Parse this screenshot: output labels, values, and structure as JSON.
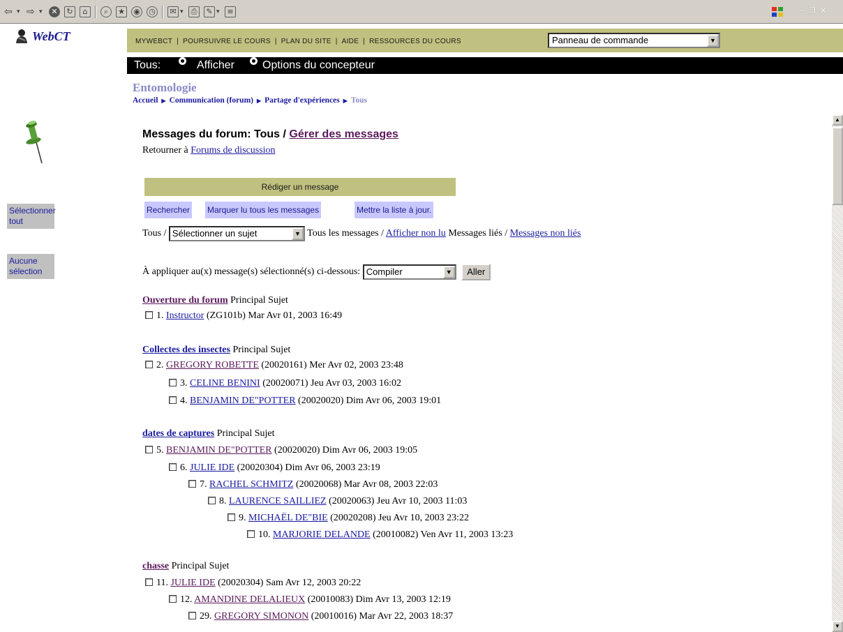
{
  "nav": {
    "links": [
      "MYWEBCT",
      "POURSUIVRE LE COURS",
      "PLAN DU SITE",
      "AIDE",
      "RESSOURCES DU COURS"
    ],
    "panel_select": "Panneau de commande"
  },
  "logo": {
    "text": "WebCT"
  },
  "mode": {
    "label": "Tous:",
    "option1": "Afficher",
    "option2": "Options du concepteur"
  },
  "course": {
    "title": "Entomologie",
    "breadcrumb": [
      "Accueil",
      "Communication (forum)",
      "Partage d'expériences"
    ],
    "breadcrumb_current": "Tous"
  },
  "sidebar": {
    "select_all": "Sélectionner tout",
    "select_none": "Aucune sélection"
  },
  "main": {
    "heading": "Messages du forum: Tous /",
    "heading_link": "Gérer des messages",
    "return_prefix": "Retourner à",
    "return_link": "Forums de discussion",
    "compose": "Rédiger un message",
    "actions": [
      "Rechercher",
      "Marquer lu tous les messages",
      "Mettre la liste à jour."
    ],
    "filter_prefix": "Tous /",
    "subject_select": "Sélectionner un sujet",
    "filter_all": "Tous  les messages /",
    "filter_unread": "Afficher non lu",
    "filter_linked": "Messages liés /",
    "filter_unlinked": "Messages non liés",
    "apply_label": "À appliquer au(x) message(s) sélectionné(s) ci-dessous:",
    "apply_select": "Compiler",
    "go": "Aller"
  },
  "topics": [
    {
      "title": "Ouverture du forum",
      "suffix": "Principal Sujet",
      "visited": true
    },
    {
      "title": "Collectes des insectes",
      "suffix": "Principal Sujet",
      "visited": false
    },
    {
      "title": "dates de captures",
      "suffix": "Principal Sujet",
      "visited": false
    },
    {
      "title": "chasse",
      "suffix": "Principal Sujet",
      "visited": true
    }
  ],
  "messages": [
    {
      "num": "1.",
      "author": "Instructor",
      "detail": "(ZG101b) Mar Avr 01, 2003 16:49"
    },
    {
      "num": "2.",
      "author": "GREGORY ROBETTE",
      "detail": "(20020161) Mer Avr 02, 2003 23:48"
    },
    {
      "num": "3.",
      "author": "CELINE BENINI",
      "detail": "(20020071) Jeu Avr 03, 2003 16:02"
    },
    {
      "num": "4.",
      "author": "BENJAMIN DE\"POTTER",
      "detail": "(20020020) Dim Avr 06, 2003 19:01"
    },
    {
      "num": "5.",
      "author": "BENJAMIN DE\"POTTER",
      "detail": "(20020020) Dim Avr 06, 2003 19:05"
    },
    {
      "num": "6.",
      "author": "JULIE IDE",
      "detail": "(20020304) Dim Avr 06, 2003 23:19"
    },
    {
      "num": "7.",
      "author": "RACHEL SCHMITZ",
      "detail": "(20020068) Mar Avr 08, 2003 22:03"
    },
    {
      "num": "8.",
      "author": "LAURENCE SAILLIEZ",
      "detail": "(20020063) Jeu Avr 10, 2003 11:03"
    },
    {
      "num": "9.",
      "author": "MICHAËL DE\"BIE",
      "detail": "(20020208) Jeu Avr 10, 2003 23:22"
    },
    {
      "num": "10.",
      "author": "MARJORIE DELANDE",
      "detail": "(20010082) Ven Avr 11, 2003 13:23"
    },
    {
      "num": "11.",
      "author": "JULIE IDE",
      "detail": "(20020304) Sam Avr 12, 2003 20:22"
    },
    {
      "num": "12.",
      "author": "AMANDINE DELALIEUX",
      "detail": "(20010083) Dim Avr 13, 2003 12:19"
    },
    {
      "num": "29.",
      "author": "GREGORY SIMONON",
      "detail": "(20010016) Mar Avr 22, 2003 18:37"
    }
  ]
}
